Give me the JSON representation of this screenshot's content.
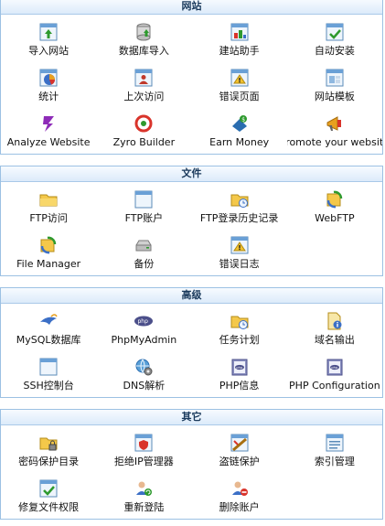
{
  "sections": [
    {
      "title": "网站",
      "items": [
        {
          "label": "导入网站",
          "icon": "window-up-arrow-icon"
        },
        {
          "label": "数据库导入",
          "icon": "database-icon"
        },
        {
          "label": "建站助手",
          "icon": "site-builder-icon"
        },
        {
          "label": "自动安装",
          "icon": "window-check-icon"
        },
        {
          "label": "统计",
          "icon": "pie-chart-icon"
        },
        {
          "label": "上次访问",
          "icon": "window-person-icon"
        },
        {
          "label": "错误页面",
          "icon": "window-warning-icon"
        },
        {
          "label": "网站模板",
          "icon": "window-template-icon"
        },
        {
          "label": "Analyze Website",
          "icon": "analyze-icon"
        },
        {
          "label": "Zyro Builder",
          "icon": "zyro-icon"
        },
        {
          "label": "Earn Money",
          "icon": "money-icon"
        },
        {
          "label": "Promote your website",
          "icon": "promote-icon"
        }
      ]
    },
    {
      "title": "文件",
      "items": [
        {
          "label": "FTP访问",
          "icon": "folder-icon"
        },
        {
          "label": "FTP账户",
          "icon": "window-icon"
        },
        {
          "label": "FTP登录历史记录",
          "icon": "folder-clock-icon"
        },
        {
          "label": "WebFTP",
          "icon": "webftp-icon"
        },
        {
          "label": "File Manager",
          "icon": "file-manager-icon"
        },
        {
          "label": "备份",
          "icon": "backup-drive-icon"
        },
        {
          "label": "错误日志",
          "icon": "window-warning-icon"
        }
      ]
    },
    {
      "title": "高级",
      "items": [
        {
          "label": "MySQL数据库",
          "icon": "mysql-icon"
        },
        {
          "label": "PhpMyAdmin",
          "icon": "php-icon"
        },
        {
          "label": "任务计划",
          "icon": "folder-clock-icon"
        },
        {
          "label": "域名输出",
          "icon": "document-info-icon"
        },
        {
          "label": "SSH控制台",
          "icon": "window-icon"
        },
        {
          "label": "DNS解析",
          "icon": "globe-gear-icon"
        },
        {
          "label": "PHP信息",
          "icon": "php-book-icon"
        },
        {
          "label": "PHP Configuration",
          "icon": "php-book-icon"
        }
      ]
    },
    {
      "title": "其它",
      "items": [
        {
          "label": "密码保护目录",
          "icon": "folder-lock-icon"
        },
        {
          "label": "拒绝IP管理器",
          "icon": "window-shield-icon"
        },
        {
          "label": "盗链保护",
          "icon": "window-chain-icon"
        },
        {
          "label": "索引管理",
          "icon": "window-list-icon"
        },
        {
          "label": "修复文件权限",
          "icon": "window-check-icon"
        },
        {
          "label": "重新登陆",
          "icon": "user-refresh-icon"
        },
        {
          "label": "删除账户",
          "icon": "user-delete-icon"
        }
      ]
    }
  ]
}
